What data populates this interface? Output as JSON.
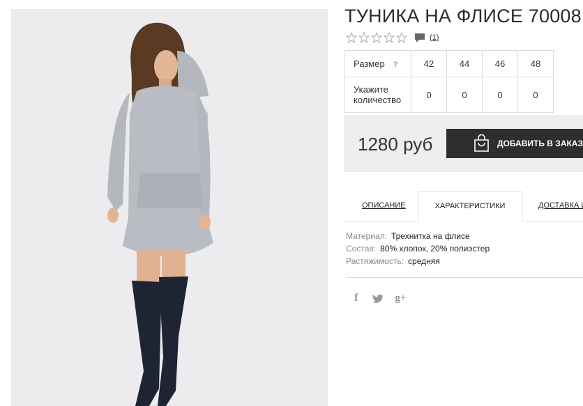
{
  "product": {
    "title": "ТУНИКА НА ФЛИСЕ 70008",
    "rating_stars": 0,
    "rating_max": 5,
    "review_count": "(1)"
  },
  "sizes": {
    "header_label": "Размер",
    "help": "?",
    "qty_label_line1": "Укажите",
    "qty_label_line2": "количество",
    "columns": [
      "42",
      "44",
      "46",
      "48"
    ],
    "quantities": [
      "0",
      "0",
      "0",
      "0"
    ]
  },
  "price": "1280 руб",
  "buy_label": "ДОБАВИТЬ В ЗАКАЗ",
  "tabs": [
    {
      "label": "ОПИСАНИЕ"
    },
    {
      "label": "ХАРАКТЕРИСТИКИ"
    },
    {
      "label": "ДОСТАВКА И"
    }
  ],
  "active_tab": "ХАРАКТЕРИСТИКИ",
  "specs": [
    {
      "key": "Материал:",
      "value": "Трехнитка на флисе"
    },
    {
      "key": "Состав:",
      "value": "80% хлопок, 20% полиэстер"
    },
    {
      "key": "Растяжимость:",
      "value": "средняя"
    }
  ],
  "social": {
    "facebook": "f",
    "twitter": "twitter-icon",
    "googleplus": "g+"
  },
  "colors": {
    "button_bg": "#2e2e2e",
    "price_bar_bg": "#eeeeee",
    "photo_bg": "#ececef",
    "dress": "#b9bcc2",
    "boots": "#1e2433"
  }
}
